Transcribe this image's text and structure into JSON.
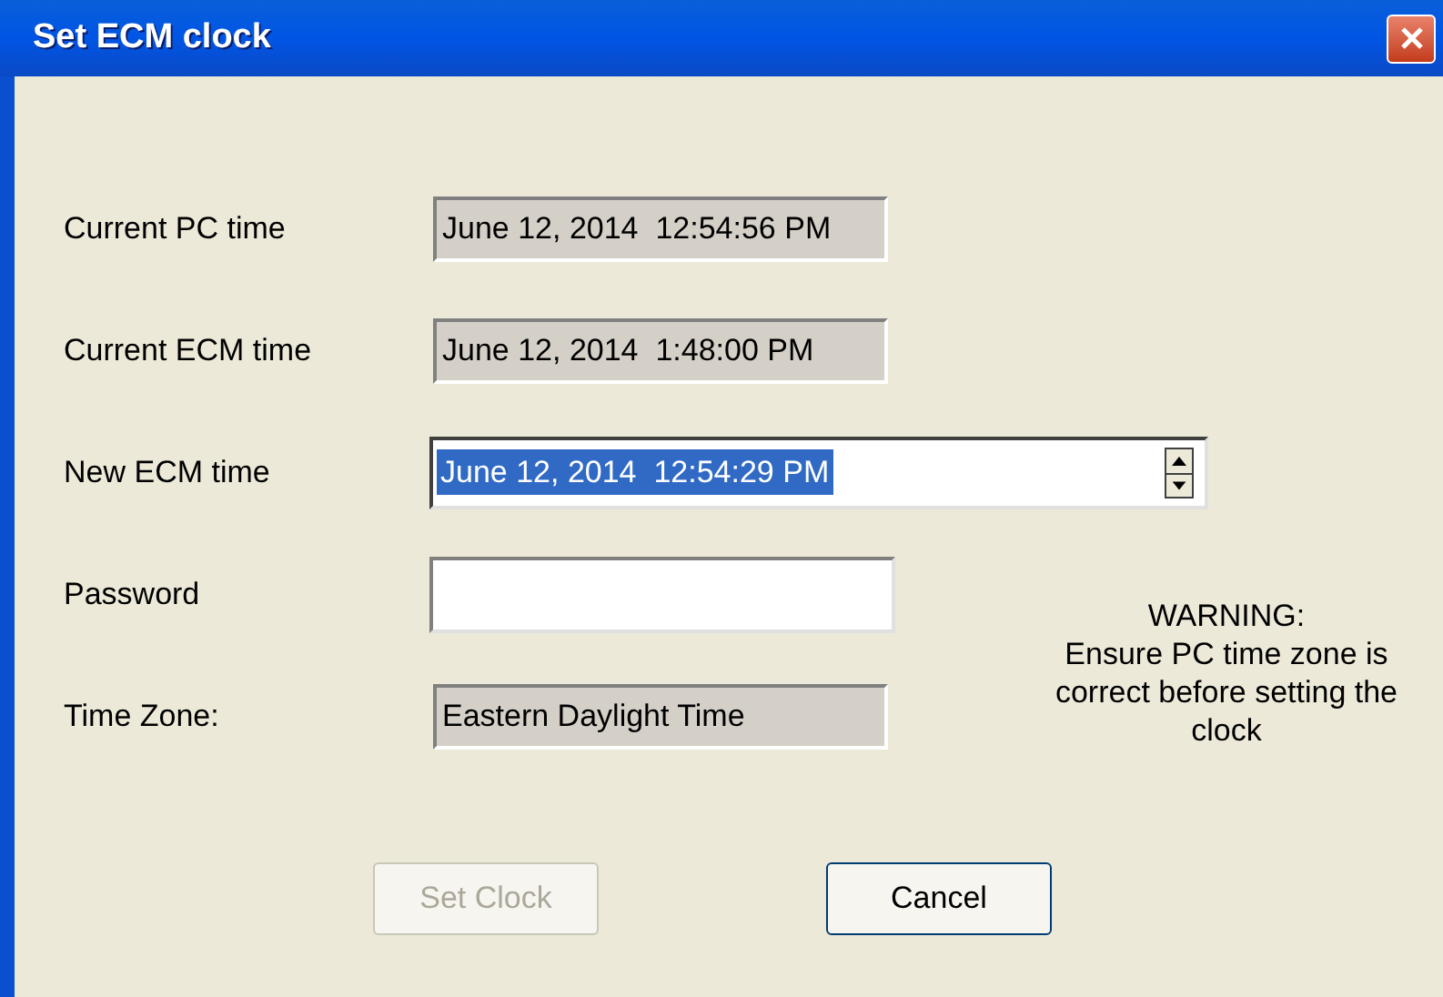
{
  "window": {
    "title": "Set ECM clock"
  },
  "fields": [
    {
      "label": "Current PC time",
      "value": "June 12, 2014  12:54:56 PM",
      "kind": "readonly"
    },
    {
      "label": "Current ECM time",
      "value": "June 12, 2014  1:48:00 PM",
      "kind": "readonly"
    },
    {
      "label": "New ECM time",
      "value": "June 12, 2014  12:54:29 PM",
      "kind": "spinner",
      "selected": true
    },
    {
      "label": "Password",
      "kind": "password"
    },
    {
      "label": "Time Zone:",
      "value": "Eastern Daylight Time",
      "kind": "readonly"
    }
  ],
  "warning": {
    "title": "WARNING:",
    "message": "Ensure PC time zone is correct before setting the clock"
  },
  "buttons": [
    {
      "label": "Set Clock",
      "disabled": true
    },
    {
      "label": "Cancel",
      "disabled": false
    }
  ]
}
